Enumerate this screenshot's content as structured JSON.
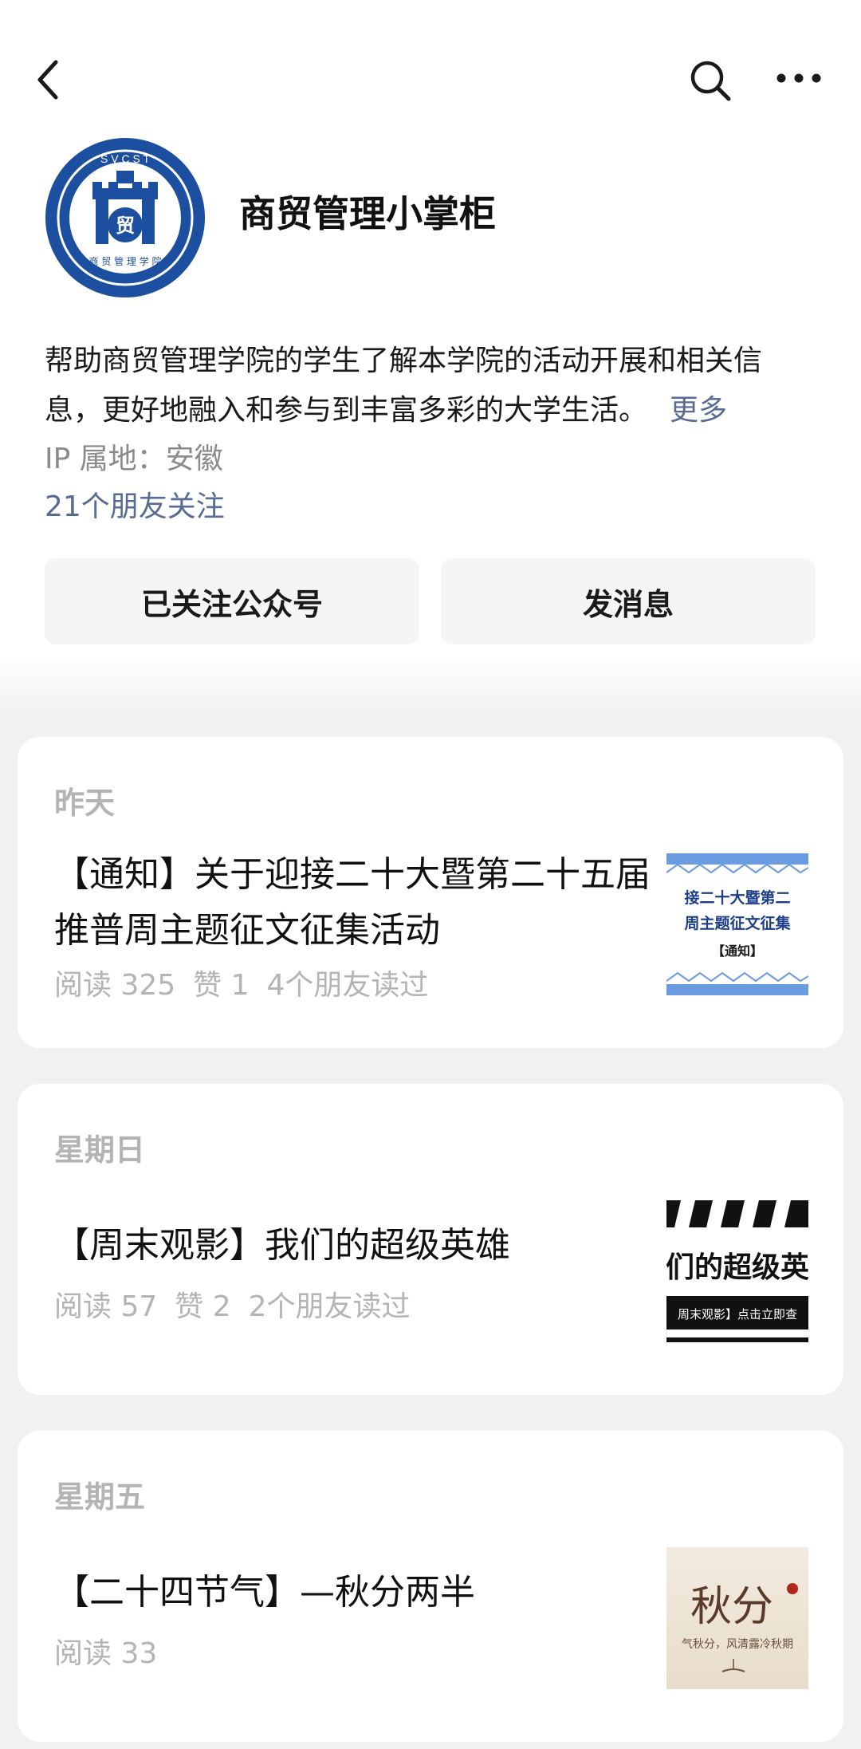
{
  "header": {
    "icons": [
      "back-icon",
      "search-icon",
      "more-icon"
    ]
  },
  "profile": {
    "name": "商贸管理小掌柜",
    "logo_text": {
      "ring": "S V C S T",
      "center": "贸",
      "bottom": "商 贸 管 理 学 院"
    },
    "description": "帮助商贸管理学院的学生了解本学院的活动开展和相关信息，更好地融入和参与到丰富多彩的大学生活。",
    "more_label": "更多",
    "ip_location": "IP 属地：安徽",
    "friends_follow": "21个朋友关注"
  },
  "actions": {
    "follow_label": "已关注公众号",
    "message_label": "发消息"
  },
  "articles": [
    {
      "date": "昨天",
      "title": "【通知】关于迎接二十大暨第二十五届推普周主题征文征集活动",
      "reads": "阅读 325",
      "likes": "赞 1",
      "friends": "4个朋友读过",
      "thumb": {
        "line1": "接二十大暨第二",
        "line2": "周主题征文征集",
        "line3": "【通知】"
      }
    },
    {
      "date": "星期日",
      "title": "【周末观影】我们的超级英雄",
      "reads": "阅读 57",
      "likes": "赞 2",
      "friends": "2个朋友读过",
      "thumb": {
        "line1": "们的超级英",
        "line2": "周末观影】点击立即查"
      }
    },
    {
      "date": "星期五",
      "title": "【二十四节气】—秋分两半",
      "reads": "阅读 33",
      "thumb": {
        "line1": "秋分",
        "line2": "气秋分，风清露冷秋期"
      }
    }
  ],
  "colors": {
    "link": "#576b95",
    "logo_blue": "#1d4fa0",
    "muted": "#b4b4b4"
  }
}
